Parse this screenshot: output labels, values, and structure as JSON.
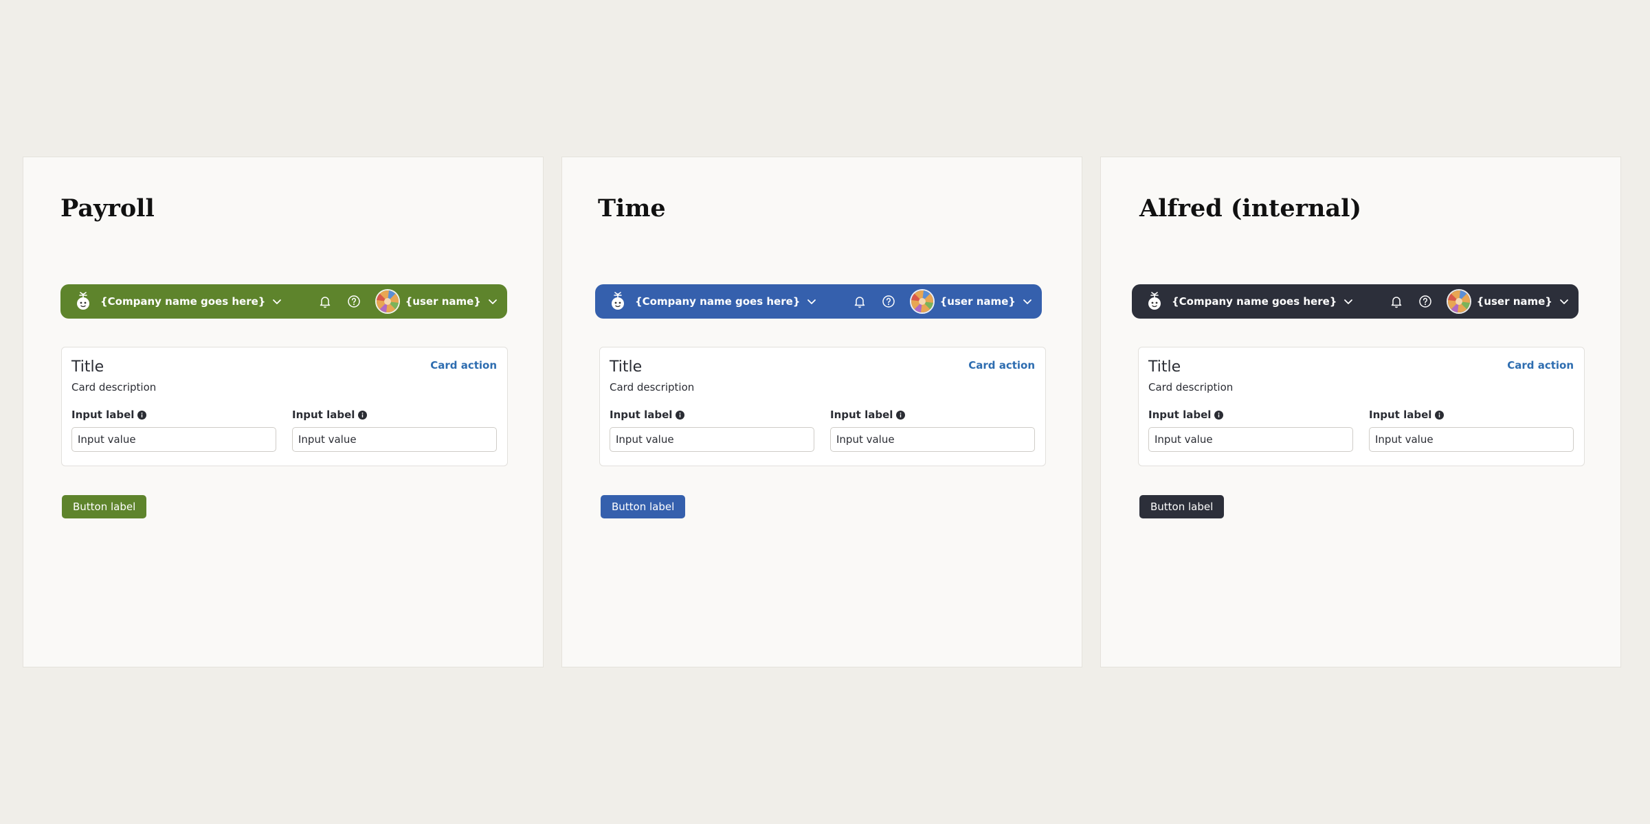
{
  "shared": {
    "company_name": "{Company name goes here}",
    "user_name": "{user name}",
    "card_title": "Title",
    "card_description": "Card description",
    "card_action": "Card action",
    "input_label": "Input label",
    "input_value": "Input value",
    "button_label": "Button label"
  },
  "panels": [
    {
      "title": "Payroll",
      "accent": "#5e842c"
    },
    {
      "title": "Time",
      "accent": "#3560ad"
    },
    {
      "title": "Alfred (internal)",
      "accent": "#2c2f3a"
    }
  ],
  "icons": {
    "logo": "palm-mascot-icon",
    "company_menu": "chevron-down-icon",
    "notifications": "bell-icon",
    "help": "question-circle-icon",
    "user_avatar": "avatar",
    "user_menu": "chevron-down-icon",
    "info": "info-icon"
  },
  "colors": {
    "page_background": "#f0eee9",
    "panel_background": "#faf9f7",
    "card_action_link": "#2e6db0"
  }
}
